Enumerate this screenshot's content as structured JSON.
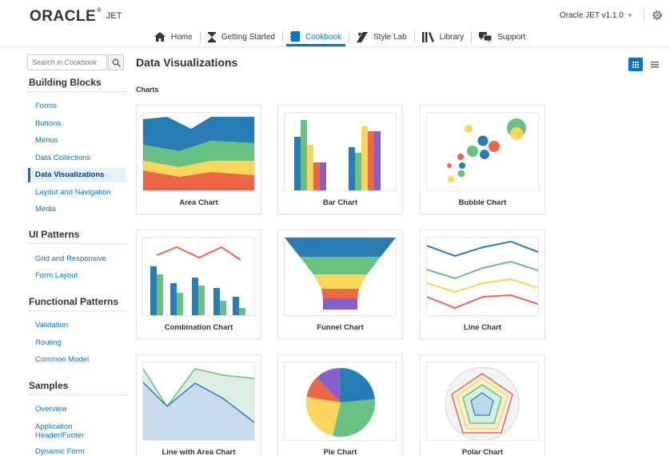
{
  "header": {
    "logo": "ORACLE",
    "logo_mark": "®",
    "product": "JET",
    "version": "Oracle JET v1.1.0",
    "version_caret": "▼",
    "nav": [
      {
        "label": "Home",
        "icon": "home-icon"
      },
      {
        "label": "Getting Started",
        "icon": "hourglass-icon"
      },
      {
        "label": "Cookbook",
        "icon": "cookbook-icon",
        "active": true
      },
      {
        "label": "Style Lab",
        "icon": "palette-icon"
      },
      {
        "label": "Library",
        "icon": "library-icon"
      },
      {
        "label": "Support",
        "icon": "support-icon"
      }
    ]
  },
  "sidebar": {
    "search_placeholder": "Search in Cookbook",
    "sections": [
      {
        "title": "Building Blocks",
        "items": [
          "Forms",
          "Buttons",
          "Menus",
          "Data Collections",
          "Data Visualizations",
          "Layout and Navigation",
          "Media"
        ]
      },
      {
        "title": "UI Patterns",
        "items": [
          "Grid and Responsive",
          "Form Layout"
        ]
      },
      {
        "title": "Functional Patterns",
        "items": [
          "Validation",
          "Routing",
          "Common Model"
        ]
      },
      {
        "title": "Samples",
        "items": [
          "Overview",
          "Application Header/Footer",
          "Dynamic Form"
        ]
      }
    ],
    "active_item": "Data Visualizations"
  },
  "main": {
    "title": "Data Visualizations",
    "section": "Charts",
    "cards": [
      {
        "label": "Area Chart"
      },
      {
        "label": "Bar Chart"
      },
      {
        "label": "Bubble Chart"
      },
      {
        "label": "Combination Chart"
      },
      {
        "label": "Funnel Chart"
      },
      {
        "label": "Line Chart"
      },
      {
        "label": "Line with Area Chart"
      },
      {
        "label": "Pie Chart"
      },
      {
        "label": "Polar Chart"
      }
    ]
  },
  "colors": {
    "accent": "#0572ce",
    "blue": "#267db3",
    "green": "#68c182",
    "yellow": "#fad55c",
    "orange": "#ed6647",
    "purple": "#8561c8",
    "teal": "#47bdef"
  }
}
